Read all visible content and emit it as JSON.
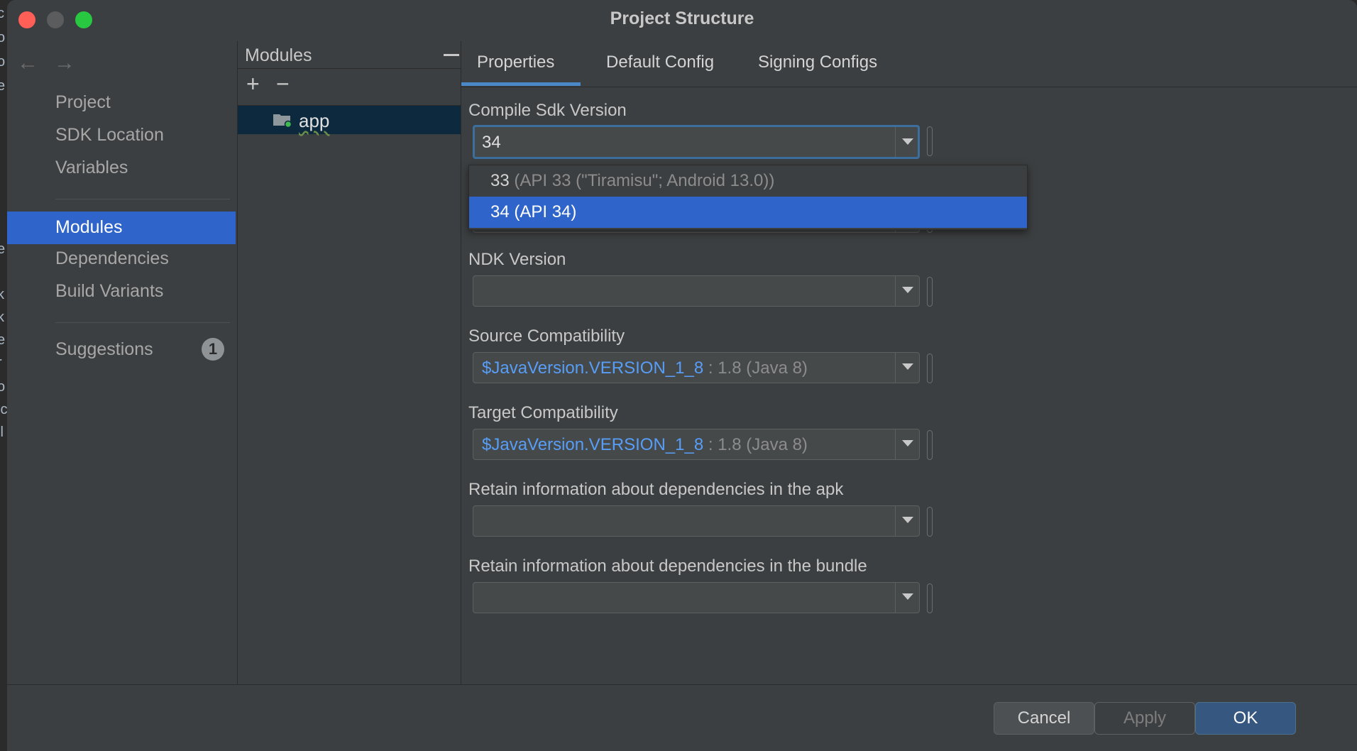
{
  "window": {
    "title": "Project Structure"
  },
  "sidebar": {
    "items": [
      {
        "label": "Project"
      },
      {
        "label": "SDK Location"
      },
      {
        "label": "Variables"
      },
      {
        "label": "Modules"
      },
      {
        "label": "Dependencies"
      },
      {
        "label": "Build Variants"
      },
      {
        "label": "Suggestions",
        "badge": "1"
      }
    ]
  },
  "modules": {
    "header": "Modules",
    "add": "+",
    "remove": "−",
    "items": [
      {
        "name": "app"
      }
    ]
  },
  "tabs": [
    {
      "label": "Properties",
      "active": true
    },
    {
      "label": "Default Config"
    },
    {
      "label": "Signing Configs"
    }
  ],
  "fields": {
    "compile_sdk": {
      "label": "Compile Sdk Version",
      "value": "34"
    },
    "ndk": {
      "label": "NDK Version",
      "value": ""
    },
    "source_compat": {
      "label": "Source Compatibility",
      "value_link": "$JavaVersion.VERSION_1_8",
      "value_rest": ": 1.8 (Java 8)"
    },
    "target_compat": {
      "label": "Target Compatibility",
      "value_link": "$JavaVersion.VERSION_1_8",
      "value_rest": ": 1.8 (Java 8)"
    },
    "retain_apk": {
      "label": "Retain information about dependencies in the apk",
      "value": ""
    },
    "retain_bundle": {
      "label": "Retain information about dependencies in the bundle",
      "value": ""
    }
  },
  "dropdown": {
    "options": [
      {
        "main": "33",
        "detail": "(API 33 (\"Tiramisu\"; Android 13.0))"
      },
      {
        "main": "34 (API 34)",
        "selected": true
      }
    ]
  },
  "footer": {
    "cancel": "Cancel",
    "apply": "Apply",
    "ok": "OK"
  },
  "colors": {
    "accent": "#2f65ca",
    "link": "#589df6",
    "close": "#ff5f57",
    "maximize": "#28c840"
  }
}
